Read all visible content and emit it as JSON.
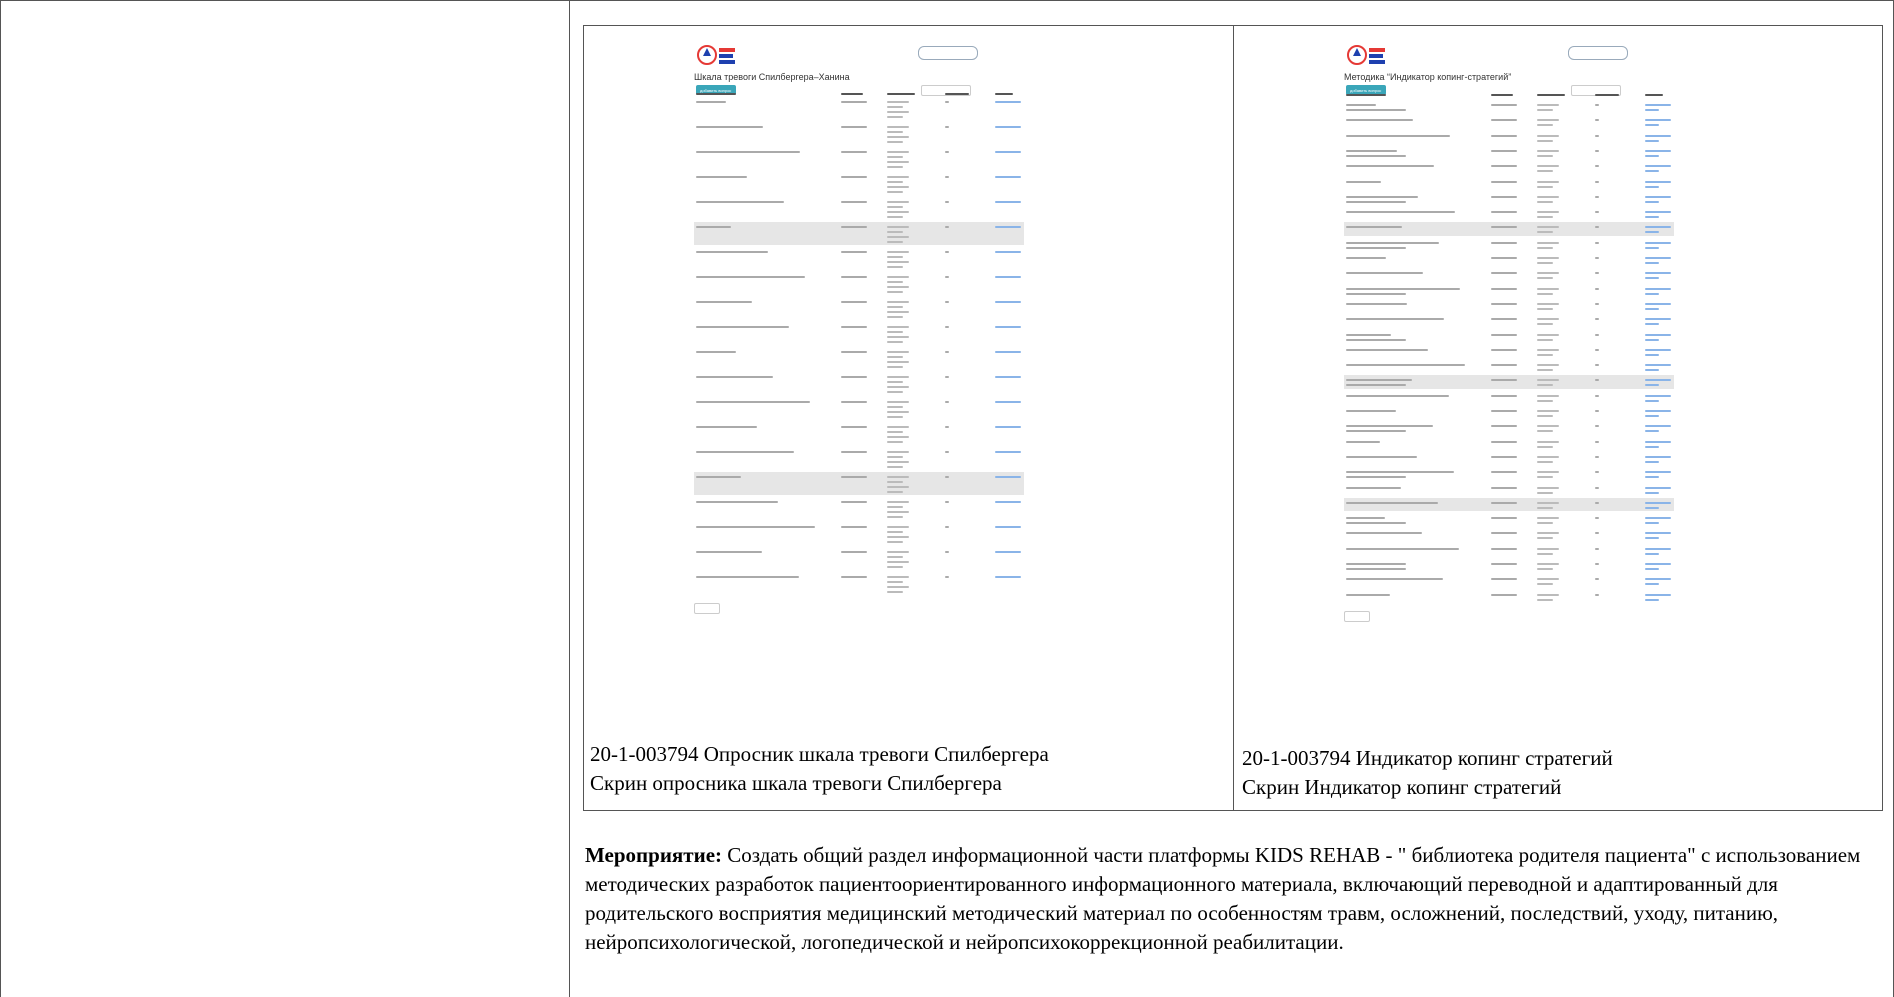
{
  "left_panel": {
    "title": "Шкала тревоги Спилбергера–Ханина",
    "add_button": "добавить вопрос",
    "row_count": 20,
    "highlight_rows": [
      5,
      15
    ],
    "options_lines_per_row": 4,
    "caption_line1": "20-1-003794 Опросник шкала тревоги Спилбергера",
    "caption_line2": "Скрин опросника шкала тревоги Спилбергера"
  },
  "right_panel": {
    "title": "Методика “Индикатор копинг-стратегий”",
    "add_button": "добавить вопрос",
    "row_count": 33,
    "highlight_rows": [
      8,
      18,
      26
    ],
    "options_lines_per_row": 2,
    "caption_line1": "20-1-003794 Индикатор копинг стратегий",
    "caption_line2": "Скрин Индикатор копинг стратегий"
  },
  "activity": {
    "label": "Мероприятие:",
    "text": " Создать общий раздел информационной части платформы KIDS REHAB - \" библиотека родителя пациента\" с использованием методических разработок пациентоориентированного информационного материала, включающий переводной и адаптированный для родительского восприятия медицинский методический материал по особенностям травм, осложнений, последствий, уходу, питанию, нейропсихологической, логопедической и нейропсихокоррекционной реабилитации."
  },
  "colors": {
    "accent_teal": "#3aa6b9",
    "link_blue": "#8ab4e8",
    "highlight_row": "#e6e6e6",
    "logo_red": "#e53935",
    "logo_blue": "#1e40af"
  }
}
